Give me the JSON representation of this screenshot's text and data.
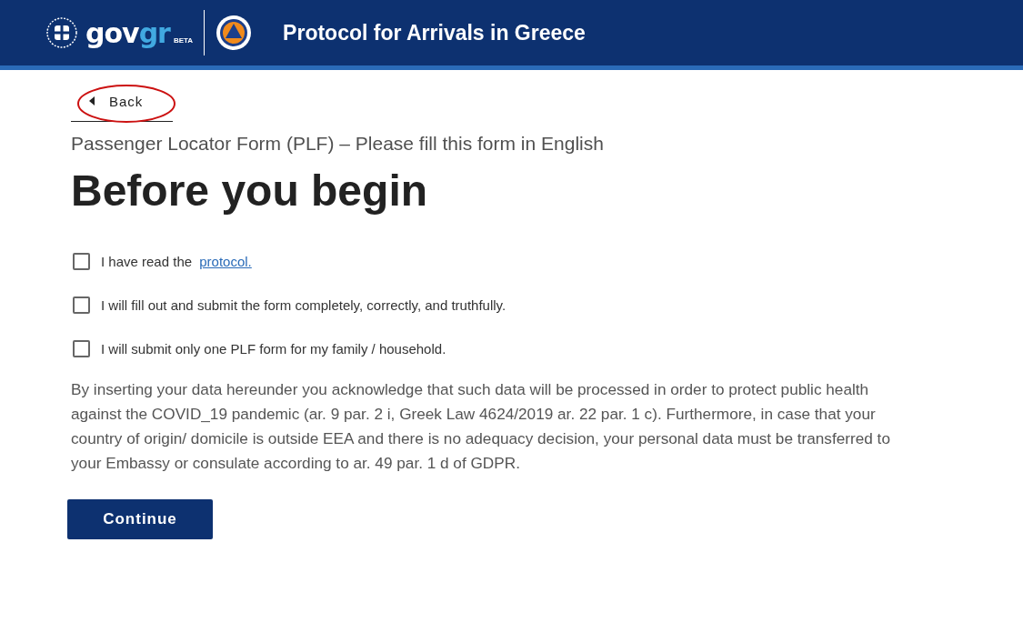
{
  "header": {
    "logo": {
      "part1": "gov",
      "part2": "gr",
      "badge": "BETA"
    },
    "title": "Protocol for Arrivals in Greece"
  },
  "back": {
    "label": "Back",
    "annotation": {
      "kind": "ellipse",
      "color": "#cc1111"
    }
  },
  "subtitle": "Passenger Locator Form (PLF) – Please fill this form in English",
  "heading": "Before you begin",
  "checkboxes": [
    {
      "text": "I have read the ",
      "link": "protocol.",
      "checked": false
    },
    {
      "text": "I will fill out and submit the form completely, correctly, and truthfully.",
      "checked": false
    },
    {
      "text": "I will submit only one PLF form for my family / household.",
      "checked": false
    }
  ],
  "notice": "By inserting your data hereunder you acknowledge that such data will be processed in order to protect public health against the COVID_19 pandemic (ar. 9 par. 2 i, Greek Law 4624/2019 ar. 22 par. 1 c). Furthermore, in case that your country of origin/ domicile is outside EEA and there is no adequacy decision, your personal data must be transferred to your Embassy or consulate according to ar. 49 par. 1 d of GDPR.",
  "continue_button": "Continue"
}
